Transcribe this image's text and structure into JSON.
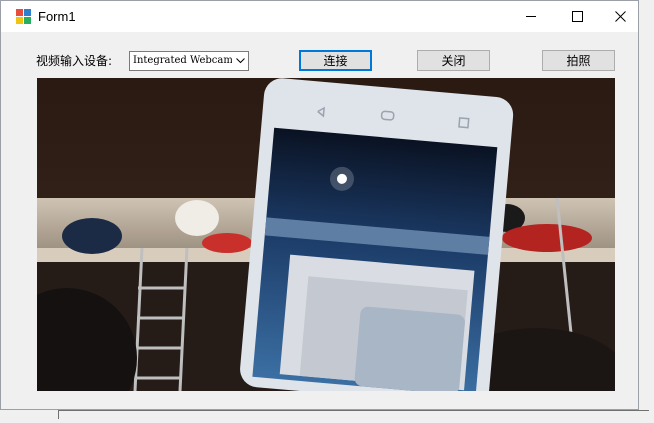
{
  "window": {
    "title": "Form1",
    "controls": {
      "minimize": "minimize",
      "maximize": "maximize",
      "close": "close"
    }
  },
  "toolbar": {
    "device_label": "视频输入设备:",
    "device_value": "Integrated Webcam",
    "connect_label": "连接",
    "close_label": "关闭",
    "photo_label": "拍照"
  },
  "icons": {
    "app": "form-app-icon",
    "dropdown": "chevron-down-icon"
  },
  "colors": {
    "titlebar": "#ffffff",
    "window_bg": "#f0f0f0",
    "focus_border": "#0078d7",
    "button_bg": "#e1e1e1"
  }
}
